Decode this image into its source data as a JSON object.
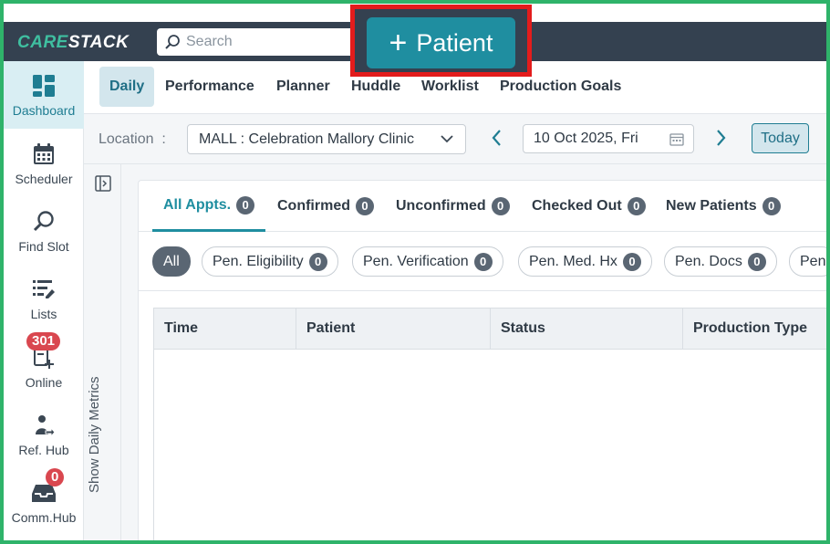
{
  "header": {
    "logo_part1": "CARE",
    "logo_part2": "STACK",
    "search_placeholder": "Search",
    "patient_button_label": "Patient",
    "colors": {
      "bar": "#344150",
      "accent": "#1f8ea0",
      "highlight_border": "#e31c1c"
    }
  },
  "sidebar": {
    "items": [
      {
        "label": "Dashboard",
        "icon": "dashboard-icon",
        "active": true
      },
      {
        "label": "Scheduler",
        "icon": "calendar-icon"
      },
      {
        "label": "Find Slot",
        "icon": "search-icon"
      },
      {
        "label": "Lists",
        "icon": "list-edit-icon"
      },
      {
        "label": "Online",
        "icon": "online-form-icon",
        "badge": "301"
      },
      {
        "label": "Ref. Hub",
        "icon": "referral-icon"
      },
      {
        "label": "Comm.Hub",
        "icon": "inbox-icon",
        "badge": "0"
      }
    ]
  },
  "nav_tabs": [
    {
      "label": "Daily",
      "active": true
    },
    {
      "label": "Performance"
    },
    {
      "label": "Planner"
    },
    {
      "label": "Huddle"
    },
    {
      "label": "Worklist"
    },
    {
      "label": "Production Goals"
    }
  ],
  "location_bar": {
    "label": "Location",
    "separator": ":",
    "selected_location": "MALL : Celebration Mallory Clinic",
    "date": "10 Oct 2025, Fri",
    "today_label": "Today"
  },
  "metrics": {
    "label": "Show Daily Metrics"
  },
  "appointment_tabs": [
    {
      "label": "All Appts.",
      "count": "0",
      "active": true
    },
    {
      "label": "Confirmed",
      "count": "0"
    },
    {
      "label": "Unconfirmed",
      "count": "0"
    },
    {
      "label": "Checked Out",
      "count": "0"
    },
    {
      "label": "New Patients",
      "count": "0"
    }
  ],
  "filter_chips": [
    {
      "label": "All",
      "active": true
    },
    {
      "label": "Pen. Eligibility",
      "count": "0"
    },
    {
      "label": "Pen. Verification",
      "count": "0"
    },
    {
      "label": "Pen. Med. Hx",
      "count": "0"
    },
    {
      "label": "Pen. Docs",
      "count": "0"
    },
    {
      "label": "Pen"
    }
  ],
  "table": {
    "columns": [
      "Time",
      "Patient",
      "Status",
      "Production Type"
    ]
  }
}
